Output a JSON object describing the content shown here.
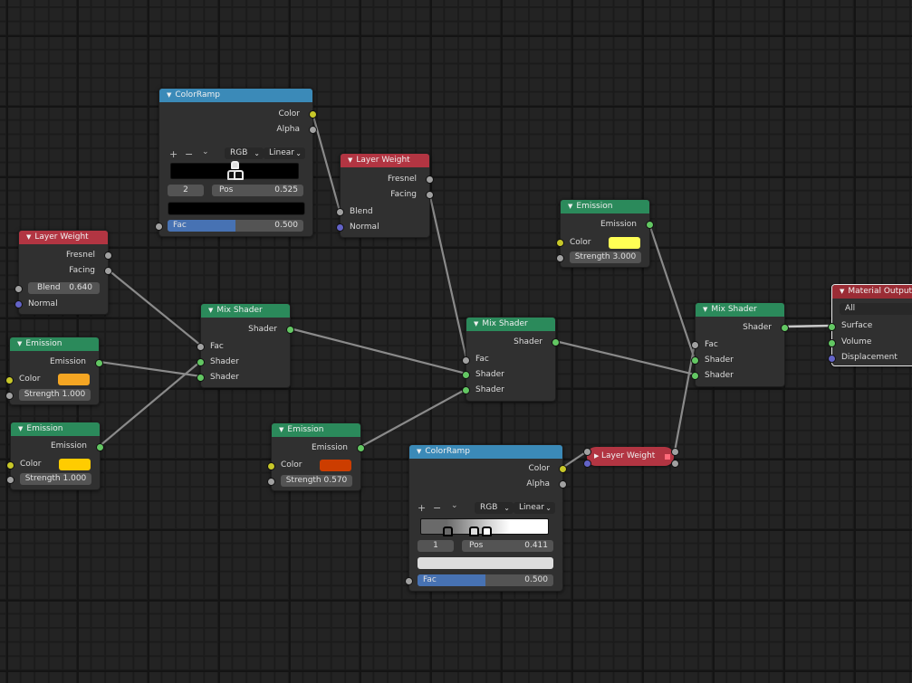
{
  "editor": {
    "type": "Shader Node Editor",
    "colors": {
      "background": "#232323",
      "input_header": "#b23542",
      "shader_header": "#2b8a5b",
      "converter_header": "#3b8ab8",
      "output_header": "#9b2c35",
      "socket_shader": "#63c763",
      "socket_color": "#c7c729",
      "socket_float": "#a1a1a1",
      "socket_vector": "#6363c7",
      "slider_fill": "#4772b3"
    }
  },
  "nodes": {
    "colorramp_top": {
      "title": "ColorRamp",
      "outputs": [
        "Color",
        "Alpha"
      ],
      "tools": {
        "add": "+",
        "remove": "−",
        "menu": "⌄"
      },
      "color_mode": "RGB",
      "interpolation": "Linear",
      "active_stop_index": "2",
      "pos_label": "Pos",
      "pos_value": "0.525",
      "stop_color": "#000000",
      "fac_label": "Fac",
      "fac_value": "0.500",
      "fac_fraction": 0.5
    },
    "layerweight_top": {
      "title": "Layer Weight",
      "outputs": [
        "Fresnel",
        "Facing"
      ],
      "inputs": [
        "Blend",
        "Normal"
      ]
    },
    "layerweight_left": {
      "title": "Layer Weight",
      "outputs": [
        "Fresnel",
        "Facing"
      ],
      "blend_label": "Blend",
      "blend_value": "0.640",
      "normal_label": "Normal"
    },
    "emission_orange": {
      "title": "Emission",
      "output": "Emission",
      "color_label": "Color",
      "color": "#f5a623",
      "strength_label": "Strength",
      "strength_value": "1.000"
    },
    "emission_yellow_left": {
      "title": "Emission",
      "output": "Emission",
      "color_label": "Color",
      "color": "#ffcc00",
      "strength_label": "Strength",
      "strength_value": "1.000"
    },
    "mixshader_left": {
      "title": "Mix Shader",
      "output": "Shader",
      "inputs": [
        "Fac",
        "Shader",
        "Shader"
      ]
    },
    "emission_red": {
      "title": "Emission",
      "output": "Emission",
      "color_label": "Color",
      "color": "#cc3d00",
      "strength_label": "Strength",
      "strength_value": "0.570"
    },
    "mixshader_mid": {
      "title": "Mix Shader",
      "output": "Shader",
      "inputs": [
        "Fac",
        "Shader",
        "Shader"
      ]
    },
    "emission_lightyellow": {
      "title": "Emission",
      "output": "Emission",
      "color_label": "Color",
      "color": "#ffff55",
      "strength_label": "Strength",
      "strength_value": "3.000"
    },
    "colorramp_bottom": {
      "title": "ColorRamp",
      "outputs": [
        "Color",
        "Alpha"
      ],
      "tools": {
        "add": "+",
        "remove": "−",
        "menu": "⌄"
      },
      "color_mode": "RGB",
      "interpolation": "Linear",
      "active_stop_index": "1",
      "pos_label": "Pos",
      "pos_value": "0.411",
      "stop_color": "#dddddd",
      "fac_label": "Fac",
      "fac_value": "0.500",
      "fac_fraction": 0.5
    },
    "layerweight_collapsed": {
      "title": "Layer Weight"
    },
    "mixshader_right": {
      "title": "Mix Shader",
      "output": "Shader",
      "inputs": [
        "Fac",
        "Shader",
        "Shader"
      ]
    },
    "material_output": {
      "title": "Material Output",
      "target": "All",
      "inputs": [
        "Surface",
        "Volume",
        "Displacement"
      ]
    }
  },
  "links": [
    {
      "from": "colorramp_top.Color",
      "to": "layerweight_top.Blend"
    },
    {
      "from": "layerweight_left.Facing",
      "to": "mixshader_left.Fac"
    },
    {
      "from": "emission_orange.Emission",
      "to": "mixshader_left.Shader2"
    },
    {
      "from": "emission_yellow_left.Emission",
      "to": "mixshader_left.Shader1"
    },
    {
      "from": "layerweight_top.Facing",
      "to": "mixshader_mid.Fac"
    },
    {
      "from": "mixshader_left.Shader",
      "to": "mixshader_mid.Shader1"
    },
    {
      "from": "emission_red.Emission",
      "to": "mixshader_mid.Shader2"
    },
    {
      "from": "emission_lightyellow.Emission",
      "to": "mixshader_right.Shader1"
    },
    {
      "from": "mixshader_mid.Shader",
      "to": "mixshader_right.Shader2"
    },
    {
      "from": "colorramp_bottom.Color",
      "to": "layerweight_collapsed.Blend"
    },
    {
      "from": "layerweight_collapsed.Facing",
      "to": "mixshader_right.Fac"
    },
    {
      "from": "mixshader_right.Shader",
      "to": "material_output.Surface"
    }
  ]
}
